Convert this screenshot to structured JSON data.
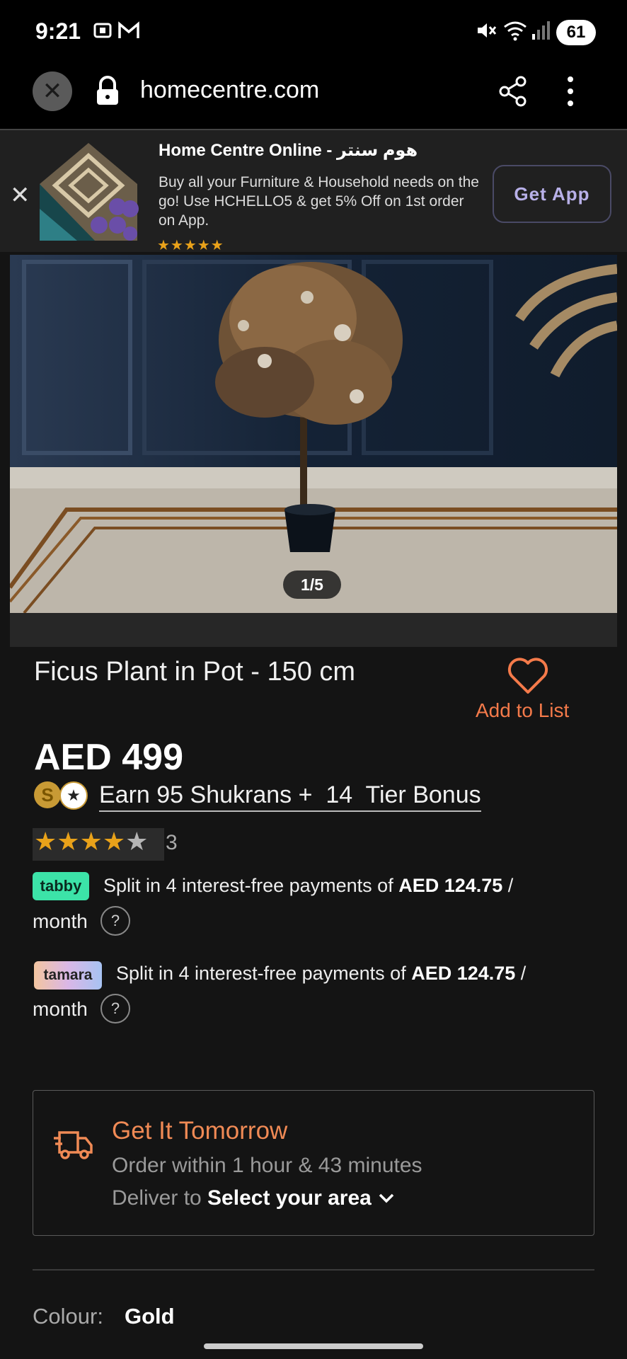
{
  "status_bar": {
    "time": "9:21",
    "battery": "61"
  },
  "browser": {
    "url": "homecentre.com"
  },
  "app_banner": {
    "title": "Home Centre Online - هوم سنتر",
    "text": "Buy all your Furniture & Household needs on the go! Use HCHELLO5 & get 5% Off on 1st order on App.",
    "stars": "★★★★★",
    "button": "Get App"
  },
  "gallery": {
    "counter": "1/5"
  },
  "product": {
    "title": "Ficus Plant in Pot - 150 cm",
    "add_to_list": "Add to List",
    "price": "AED 499",
    "coin_symbol": "S",
    "shukran": "Earn 95 Shukrans +  14  Tier Bonus",
    "rating_value": 4,
    "rating_count": "3"
  },
  "payments": {
    "tabby": {
      "logo": "tabby",
      "text": "Split in 4 interest-free payments of ",
      "amount": "AED 124.75",
      "suffix": " /",
      "month": "month",
      "help": "?"
    },
    "tamara": {
      "logo": "tamara",
      "text": "Split in 4 interest-free payments of ",
      "amount": "AED 124.75",
      "suffix": " /",
      "month": "month",
      "help": "?"
    }
  },
  "delivery": {
    "title": "Get It Tomorrow",
    "order_within": "Order within 1 hour & 43 minutes",
    "deliver_to_label": "Deliver to ",
    "deliver_to_value": "Select your area"
  },
  "colour": {
    "label": "Colour:",
    "value": "Gold"
  },
  "colors": {
    "accent": "#f47a4a",
    "star": "#e9a21a",
    "tabby": "#3ce3a8"
  }
}
